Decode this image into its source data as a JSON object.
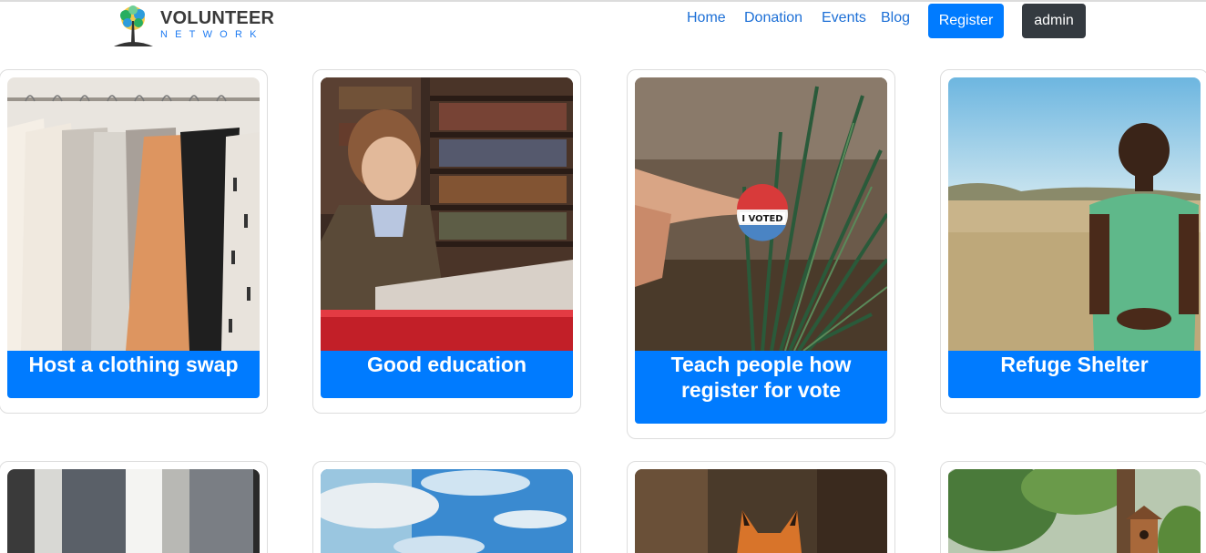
{
  "brand": {
    "title": "VOLUNTEER",
    "subtitle": "NETWORK"
  },
  "nav": {
    "links": [
      "Home",
      "Donation",
      "Events",
      "Blog"
    ],
    "register_label": "Register",
    "admin_label": "admin"
  },
  "colors": {
    "accent": "#007bff",
    "dark": "#343a40",
    "link": "#1c6fd6"
  },
  "events": [
    {
      "title": "Host a clothing swap",
      "image": "clothing-rack-photo"
    },
    {
      "title": "Good education",
      "image": "boy-reading-library-photo"
    },
    {
      "title": "Teach people how register for vote",
      "image": "i-voted-sticker-photo"
    },
    {
      "title": "Refuge Shelter",
      "image": "child-in-field-photo"
    },
    {
      "title": "",
      "image": "window-interior-photo"
    },
    {
      "title": "",
      "image": "blue-sky-clouds-photo"
    },
    {
      "title": "",
      "image": "fox-in-forest-photo"
    },
    {
      "title": "",
      "image": "birdhouse-trees-photo"
    }
  ]
}
